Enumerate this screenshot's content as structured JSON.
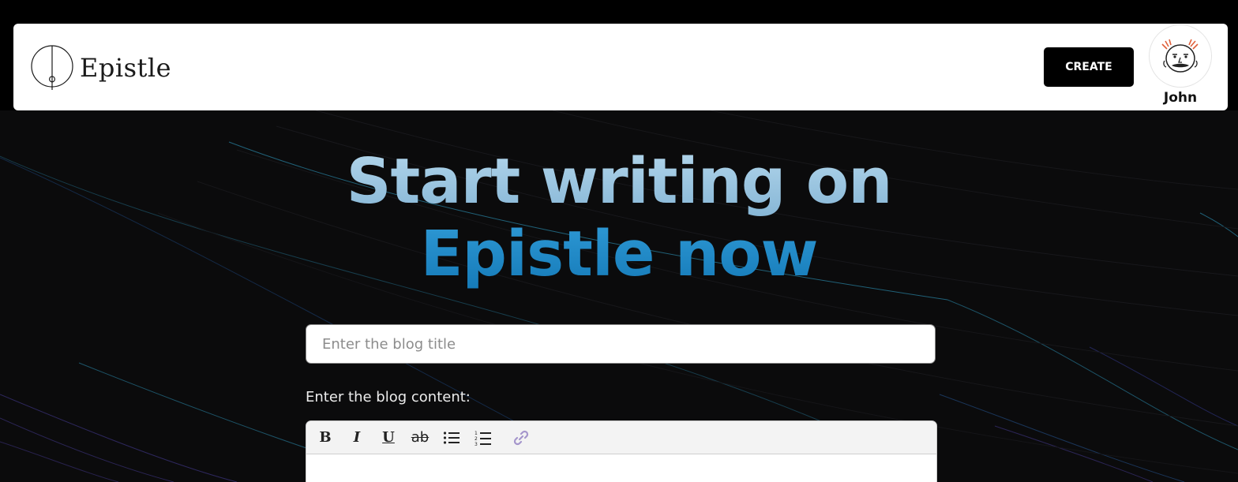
{
  "navbar": {
    "brand_name": "Epistle",
    "logo_icon": "epistle-logo-icon",
    "create_label": "CREATE",
    "user_name": "John",
    "avatar_icon": "avatar-icon"
  },
  "hero": {
    "line1": "Start writing on",
    "line2": "Epistle now"
  },
  "form": {
    "title_placeholder": "Enter the blog title",
    "title_value": "",
    "content_label": "Enter the blog content:",
    "toolbar": [
      {
        "name": "bold-button",
        "label": "B"
      },
      {
        "name": "italic-button",
        "label": "I"
      },
      {
        "name": "underline-button",
        "label": "U"
      },
      {
        "name": "strikethrough-button",
        "label": "ab"
      },
      {
        "name": "bullet-list-button",
        "icon": "bullet-list-icon"
      },
      {
        "name": "numbered-list-button",
        "icon": "numbered-list-icon"
      },
      {
        "name": "link-button",
        "icon": "link-icon"
      }
    ]
  },
  "colors": {
    "hero_line1": "#9cc6e0",
    "hero_line2": "#1e8bc9",
    "page_background": "#0b0b0c",
    "button_background": "#000000"
  }
}
